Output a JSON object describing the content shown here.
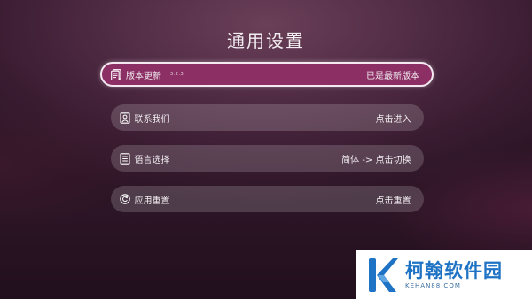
{
  "page": {
    "title": "通用设置"
  },
  "menu": {
    "items": [
      {
        "label": "版本更新",
        "version": "3.2.3",
        "action": "已是最新版本",
        "icon": "document-icon"
      },
      {
        "label": "联系我们",
        "action": "点击进入",
        "icon": "contact-icon"
      },
      {
        "label": "语言选择",
        "action": "简体 -> 点击切换",
        "icon": "list-icon"
      },
      {
        "label": "应用重置",
        "action": "点击重置",
        "icon": "reset-icon"
      }
    ]
  },
  "watermark": {
    "title": "柯翰软件园",
    "url": "KEHAN88.COM"
  },
  "colors": {
    "background": "#4e2a42",
    "focus": "#8c2f64",
    "watermark_blue": "#1f73c4"
  }
}
